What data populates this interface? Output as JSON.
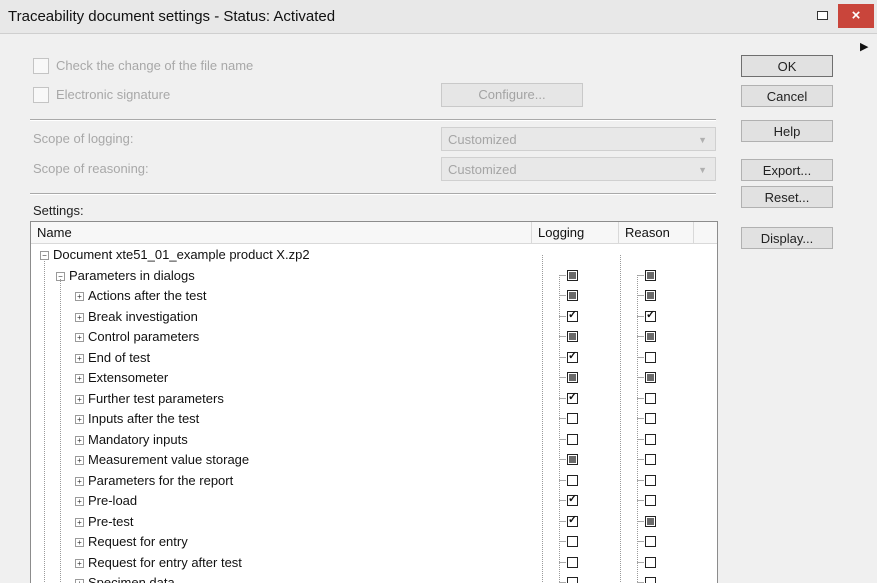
{
  "window": {
    "title": "Traceability document settings - Status: Activated",
    "close_label": "×"
  },
  "options": {
    "check_filename_label": "Check the change of the file name",
    "electronic_signature_label": "Electronic signature",
    "configure_button": "Configure..."
  },
  "scope": {
    "logging_label": "Scope of logging:",
    "logging_value": "Customized",
    "reasoning_label": "Scope of reasoning:",
    "reasoning_value": "Customized"
  },
  "settings_label": "Settings:",
  "side_buttons": {
    "ok": "OK",
    "cancel": "Cancel",
    "help": "Help",
    "export": "Export...",
    "reset": "Reset...",
    "display": "Display..."
  },
  "grid": {
    "columns": {
      "name": "Name",
      "logging": "Logging",
      "reason": "Reason"
    },
    "root": "Document xte51_01_example product X.zp2",
    "group": {
      "label": "Parameters in dialogs",
      "logging": "partial",
      "reason": "partial"
    },
    "rows": [
      {
        "label": "Actions after the test",
        "logging": "partial",
        "reason": "partial"
      },
      {
        "label": "Break investigation",
        "logging": "checked",
        "reason": "checked"
      },
      {
        "label": "Control parameters",
        "logging": "partial",
        "reason": "partial"
      },
      {
        "label": "End of test",
        "logging": "checked",
        "reason": "unchecked"
      },
      {
        "label": "Extensometer",
        "logging": "partial",
        "reason": "partial"
      },
      {
        "label": "Further test parameters",
        "logging": "checked",
        "reason": "unchecked"
      },
      {
        "label": "Inputs after the test",
        "logging": "unchecked",
        "reason": "unchecked"
      },
      {
        "label": "Mandatory inputs",
        "logging": "unchecked",
        "reason": "unchecked"
      },
      {
        "label": "Measurement value storage",
        "logging": "partial",
        "reason": "unchecked"
      },
      {
        "label": "Parameters for the report",
        "logging": "unchecked",
        "reason": "unchecked"
      },
      {
        "label": "Pre-load",
        "logging": "checked",
        "reason": "unchecked"
      },
      {
        "label": "Pre-test",
        "logging": "checked",
        "reason": "partial"
      },
      {
        "label": "Request for entry",
        "logging": "unchecked",
        "reason": "unchecked"
      },
      {
        "label": "Request for entry after test",
        "logging": "unchecked",
        "reason": "unchecked"
      },
      {
        "label": "Specimen data",
        "logging": "unchecked",
        "reason": "unchecked"
      }
    ]
  }
}
